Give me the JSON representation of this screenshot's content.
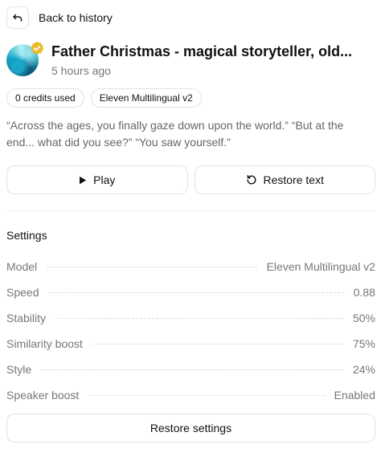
{
  "back": {
    "label": "Back to history",
    "icon": "return-arrow-icon"
  },
  "header": {
    "title": "Father Christmas - magical storyteller, old...",
    "subtitle": "5 hours ago",
    "verified_color": "#e8b92b"
  },
  "chips": [
    {
      "label": "0 credits used"
    },
    {
      "label": "Eleven Multilingual v2"
    }
  ],
  "quote": "“Across the ages, you finally gaze down upon the world.” “But at the end... what did you see?” “You saw yourself.”",
  "actions": {
    "play_label": "Play",
    "play_icon": "play-icon",
    "restore_text_label": "Restore text",
    "restore_text_icon": "rotate-ccw-icon"
  },
  "settings": {
    "title": "Settings",
    "rows": [
      {
        "label": "Model",
        "value": "Eleven Multilingual v2"
      },
      {
        "label": "Speed",
        "value": "0.88"
      },
      {
        "label": "Stability",
        "value": "50%"
      },
      {
        "label": "Similarity boost",
        "value": "75%"
      },
      {
        "label": "Style",
        "value": "24%"
      },
      {
        "label": "Speaker boost",
        "value": "Enabled"
      }
    ],
    "restore_label": "Restore settings"
  }
}
